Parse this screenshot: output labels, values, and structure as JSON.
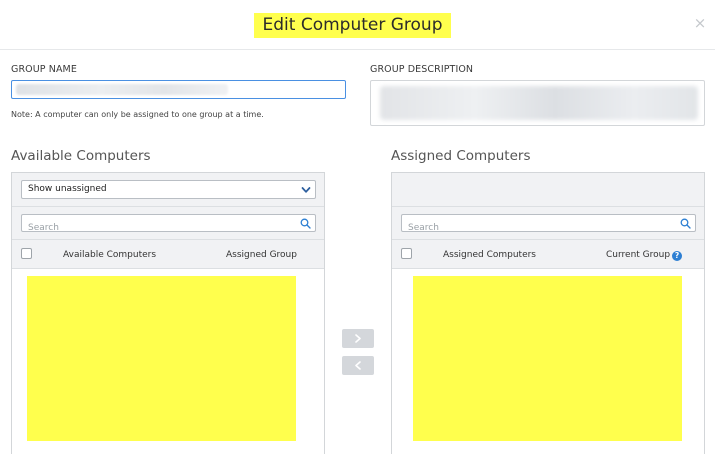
{
  "dialog": {
    "title": "Edit Computer Group",
    "close_icon": "close-icon",
    "close_glyph": "×"
  },
  "form": {
    "group_name_label": "GROUP NAME",
    "group_description_label": "GROUP DESCRIPTION",
    "note": "Note: A computer can only be assigned to one group at a time."
  },
  "available": {
    "section_title": "Available Computers",
    "filter_value": "Show unassigned",
    "search_placeholder": "Search",
    "col_name": "Available Computers",
    "col_group": "Assigned Group"
  },
  "assigned": {
    "section_title": "Assigned Computers",
    "search_placeholder": "Search",
    "col_name": "Assigned Computers",
    "col_group": "Current Group",
    "help_glyph": "?"
  },
  "transfer": {
    "add_icon": "chevron-right-icon",
    "remove_icon": "chevron-left-icon"
  },
  "colors": {
    "accent": "#2d7fd3",
    "highlight": "#ffff4d",
    "focus_border": "#4a90e2"
  }
}
